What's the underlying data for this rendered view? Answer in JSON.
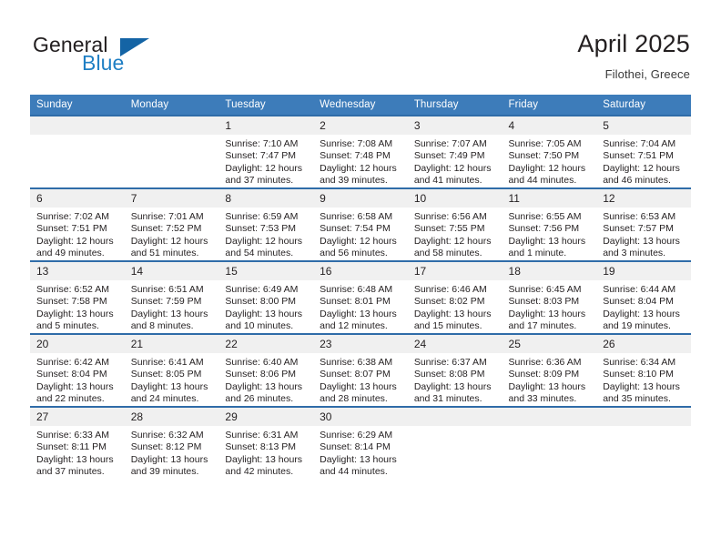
{
  "brand": {
    "word_one": "General",
    "word_two": "Blue",
    "triangle_icon": "brand-triangle-icon",
    "accent_color": "#1f7fc4",
    "triangle_color": "#1464a5"
  },
  "header": {
    "title": "April 2025",
    "subtitle": "Filothei, Greece"
  },
  "theme": {
    "header_blue": "#3d7cba",
    "row_border_blue": "#2f6ca8",
    "daynum_background": "#f0f0f0",
    "text_color": "#231f20"
  },
  "weekday_headers": [
    "Sunday",
    "Monday",
    "Tuesday",
    "Wednesday",
    "Thursday",
    "Friday",
    "Saturday"
  ],
  "weeks": [
    [
      {
        "day": "",
        "sunrise": "",
        "sunset": "",
        "daylight": "",
        "daylight2": ""
      },
      {
        "day": "",
        "sunrise": "",
        "sunset": "",
        "daylight": "",
        "daylight2": ""
      },
      {
        "day": "1",
        "sunrise": "Sunrise: 7:10 AM",
        "sunset": "Sunset: 7:47 PM",
        "daylight": "Daylight: 12 hours",
        "daylight2": "and 37 minutes."
      },
      {
        "day": "2",
        "sunrise": "Sunrise: 7:08 AM",
        "sunset": "Sunset: 7:48 PM",
        "daylight": "Daylight: 12 hours",
        "daylight2": "and 39 minutes."
      },
      {
        "day": "3",
        "sunrise": "Sunrise: 7:07 AM",
        "sunset": "Sunset: 7:49 PM",
        "daylight": "Daylight: 12 hours",
        "daylight2": "and 41 minutes."
      },
      {
        "day": "4",
        "sunrise": "Sunrise: 7:05 AM",
        "sunset": "Sunset: 7:50 PM",
        "daylight": "Daylight: 12 hours",
        "daylight2": "and 44 minutes."
      },
      {
        "day": "5",
        "sunrise": "Sunrise: 7:04 AM",
        "sunset": "Sunset: 7:51 PM",
        "daylight": "Daylight: 12 hours",
        "daylight2": "and 46 minutes."
      }
    ],
    [
      {
        "day": "6",
        "sunrise": "Sunrise: 7:02 AM",
        "sunset": "Sunset: 7:51 PM",
        "daylight": "Daylight: 12 hours",
        "daylight2": "and 49 minutes."
      },
      {
        "day": "7",
        "sunrise": "Sunrise: 7:01 AM",
        "sunset": "Sunset: 7:52 PM",
        "daylight": "Daylight: 12 hours",
        "daylight2": "and 51 minutes."
      },
      {
        "day": "8",
        "sunrise": "Sunrise: 6:59 AM",
        "sunset": "Sunset: 7:53 PM",
        "daylight": "Daylight: 12 hours",
        "daylight2": "and 54 minutes."
      },
      {
        "day": "9",
        "sunrise": "Sunrise: 6:58 AM",
        "sunset": "Sunset: 7:54 PM",
        "daylight": "Daylight: 12 hours",
        "daylight2": "and 56 minutes."
      },
      {
        "day": "10",
        "sunrise": "Sunrise: 6:56 AM",
        "sunset": "Sunset: 7:55 PM",
        "daylight": "Daylight: 12 hours",
        "daylight2": "and 58 minutes."
      },
      {
        "day": "11",
        "sunrise": "Sunrise: 6:55 AM",
        "sunset": "Sunset: 7:56 PM",
        "daylight": "Daylight: 13 hours",
        "daylight2": "and 1 minute."
      },
      {
        "day": "12",
        "sunrise": "Sunrise: 6:53 AM",
        "sunset": "Sunset: 7:57 PM",
        "daylight": "Daylight: 13 hours",
        "daylight2": "and 3 minutes."
      }
    ],
    [
      {
        "day": "13",
        "sunrise": "Sunrise: 6:52 AM",
        "sunset": "Sunset: 7:58 PM",
        "daylight": "Daylight: 13 hours",
        "daylight2": "and 5 minutes."
      },
      {
        "day": "14",
        "sunrise": "Sunrise: 6:51 AM",
        "sunset": "Sunset: 7:59 PM",
        "daylight": "Daylight: 13 hours",
        "daylight2": "and 8 minutes."
      },
      {
        "day": "15",
        "sunrise": "Sunrise: 6:49 AM",
        "sunset": "Sunset: 8:00 PM",
        "daylight": "Daylight: 13 hours",
        "daylight2": "and 10 minutes."
      },
      {
        "day": "16",
        "sunrise": "Sunrise: 6:48 AM",
        "sunset": "Sunset: 8:01 PM",
        "daylight": "Daylight: 13 hours",
        "daylight2": "and 12 minutes."
      },
      {
        "day": "17",
        "sunrise": "Sunrise: 6:46 AM",
        "sunset": "Sunset: 8:02 PM",
        "daylight": "Daylight: 13 hours",
        "daylight2": "and 15 minutes."
      },
      {
        "day": "18",
        "sunrise": "Sunrise: 6:45 AM",
        "sunset": "Sunset: 8:03 PM",
        "daylight": "Daylight: 13 hours",
        "daylight2": "and 17 minutes."
      },
      {
        "day": "19",
        "sunrise": "Sunrise: 6:44 AM",
        "sunset": "Sunset: 8:04 PM",
        "daylight": "Daylight: 13 hours",
        "daylight2": "and 19 minutes."
      }
    ],
    [
      {
        "day": "20",
        "sunrise": "Sunrise: 6:42 AM",
        "sunset": "Sunset: 8:04 PM",
        "daylight": "Daylight: 13 hours",
        "daylight2": "and 22 minutes."
      },
      {
        "day": "21",
        "sunrise": "Sunrise: 6:41 AM",
        "sunset": "Sunset: 8:05 PM",
        "daylight": "Daylight: 13 hours",
        "daylight2": "and 24 minutes."
      },
      {
        "day": "22",
        "sunrise": "Sunrise: 6:40 AM",
        "sunset": "Sunset: 8:06 PM",
        "daylight": "Daylight: 13 hours",
        "daylight2": "and 26 minutes."
      },
      {
        "day": "23",
        "sunrise": "Sunrise: 6:38 AM",
        "sunset": "Sunset: 8:07 PM",
        "daylight": "Daylight: 13 hours",
        "daylight2": "and 28 minutes."
      },
      {
        "day": "24",
        "sunrise": "Sunrise: 6:37 AM",
        "sunset": "Sunset: 8:08 PM",
        "daylight": "Daylight: 13 hours",
        "daylight2": "and 31 minutes."
      },
      {
        "day": "25",
        "sunrise": "Sunrise: 6:36 AM",
        "sunset": "Sunset: 8:09 PM",
        "daylight": "Daylight: 13 hours",
        "daylight2": "and 33 minutes."
      },
      {
        "day": "26",
        "sunrise": "Sunrise: 6:34 AM",
        "sunset": "Sunset: 8:10 PM",
        "daylight": "Daylight: 13 hours",
        "daylight2": "and 35 minutes."
      }
    ],
    [
      {
        "day": "27",
        "sunrise": "Sunrise: 6:33 AM",
        "sunset": "Sunset: 8:11 PM",
        "daylight": "Daylight: 13 hours",
        "daylight2": "and 37 minutes."
      },
      {
        "day": "28",
        "sunrise": "Sunrise: 6:32 AM",
        "sunset": "Sunset: 8:12 PM",
        "daylight": "Daylight: 13 hours",
        "daylight2": "and 39 minutes."
      },
      {
        "day": "29",
        "sunrise": "Sunrise: 6:31 AM",
        "sunset": "Sunset: 8:13 PM",
        "daylight": "Daylight: 13 hours",
        "daylight2": "and 42 minutes."
      },
      {
        "day": "30",
        "sunrise": "Sunrise: 6:29 AM",
        "sunset": "Sunset: 8:14 PM",
        "daylight": "Daylight: 13 hours",
        "daylight2": "and 44 minutes."
      },
      {
        "day": "",
        "sunrise": "",
        "sunset": "",
        "daylight": "",
        "daylight2": ""
      },
      {
        "day": "",
        "sunrise": "",
        "sunset": "",
        "daylight": "",
        "daylight2": ""
      },
      {
        "day": "",
        "sunrise": "",
        "sunset": "",
        "daylight": "",
        "daylight2": ""
      }
    ]
  ]
}
